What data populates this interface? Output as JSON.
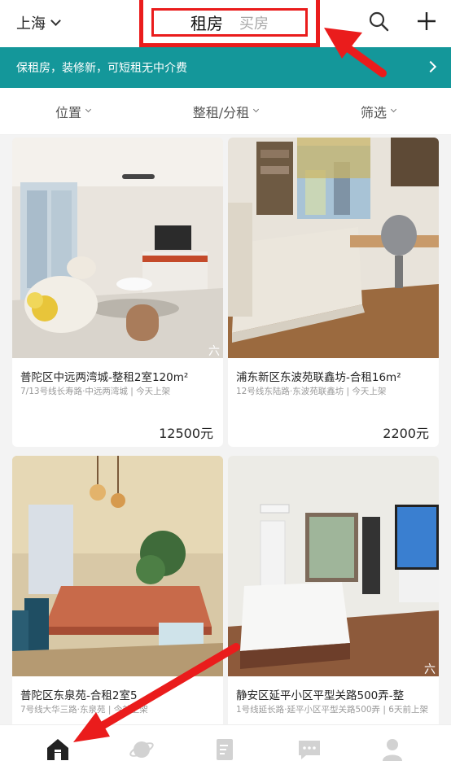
{
  "header": {
    "city": "上海",
    "tabs": {
      "rent": "租房",
      "buy": "买房"
    }
  },
  "promo": {
    "text": "保租房，装修新，可短租无中介费"
  },
  "filters": [
    "位置",
    "整租/分租",
    "筛选"
  ],
  "listings": [
    {
      "title": "普陀区中远两湾城-整租2室120m²",
      "sub": "7/13号线长寿路·中远两湾城 | 今天上架",
      "price": "12500元",
      "watermark": "六"
    },
    {
      "title": "浦东新区东波苑联鑫坊-合租16m²",
      "sub": "12号线东陆路·东波苑联鑫坊 | 今天上架",
      "price": "2200元",
      "watermark": ""
    },
    {
      "title": "普陀区东泉苑-合租2室5",
      "sub": "7号线大华三路·东泉苑 | 今前上架",
      "price": "",
      "watermark": ""
    },
    {
      "title": "静安区延平小区平型关路500弄-整",
      "sub": "1号线延长路·延平小区平型关路500弄 | 6天前上架",
      "price": "",
      "watermark": "六"
    }
  ],
  "colors": {
    "accent": "#14979a",
    "highlight": "#ea1c1c"
  },
  "nav_icons": [
    "home-icon",
    "planet-icon",
    "note-icon",
    "chat-icon",
    "profile-icon"
  ]
}
